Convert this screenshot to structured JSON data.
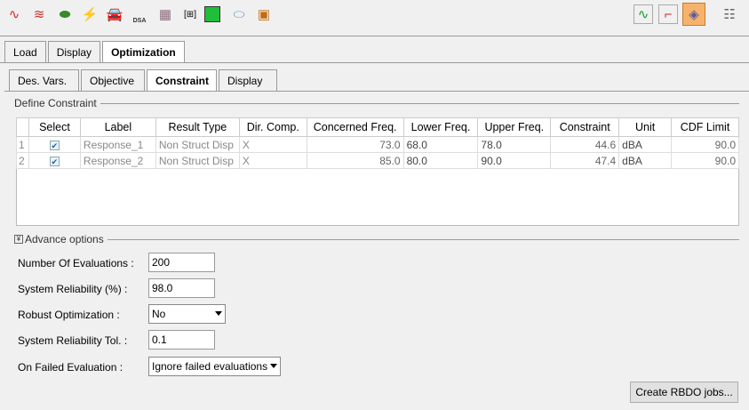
{
  "toolbar": {
    "left_icons": [
      "curve-icon",
      "peak-icon",
      "car-model-icon",
      "contour-icon",
      "car-loads-icon",
      "dsa-icon",
      "panel-icon",
      "matrix-icon",
      "green-plot-icon",
      "cylinder-icon",
      "cube-split-icon"
    ],
    "dsa_text": "DSA",
    "right_icons": [
      "wave-plot-icon",
      "growth-plot-icon",
      "optimization-folder-icon",
      "database-icon"
    ]
  },
  "tabs": [
    "Load",
    "Display",
    "Optimization"
  ],
  "subtabs": [
    "Des. Vars.",
    "Objective",
    "Constraint",
    "Display"
  ],
  "group_title": "Define Constraint",
  "table": {
    "headers": [
      "Select",
      "Label",
      "Result Type",
      "Dir. Comp.",
      "Concerned Freq.",
      "Lower Freq.",
      "Upper Freq.",
      "Constraint",
      "Unit",
      "CDF Limit"
    ],
    "rows": [
      {
        "n": "1",
        "select": true,
        "label": "Response_1",
        "type": "Non Struct Disp",
        "dir": "X",
        "concerned": "73.0",
        "lower": "68.0",
        "upper": "78.0",
        "constraint": "44.6",
        "unit": "dBA",
        "cdf": "90.0"
      },
      {
        "n": "2",
        "select": true,
        "label": "Response_2",
        "type": "Non Struct Disp",
        "dir": "X",
        "concerned": "85.0",
        "lower": "80.0",
        "upper": "90.0",
        "constraint": "47.4",
        "unit": "dBA",
        "cdf": "90.0"
      }
    ]
  },
  "advance": {
    "title": "Advance options",
    "num_eval_label": "Number Of Evaluations :",
    "num_eval": "200",
    "reliability_label": "System Reliability (%) :",
    "reliability": "98.0",
    "robust_label": "Robust Optimization :",
    "robust": "No",
    "tol_label": "System Reliability Tol. :",
    "tol": "0.1",
    "failed_label": "On Failed Evaluation :",
    "failed": "Ignore failed evaluations"
  },
  "create_button": "Create RBDO jobs..."
}
